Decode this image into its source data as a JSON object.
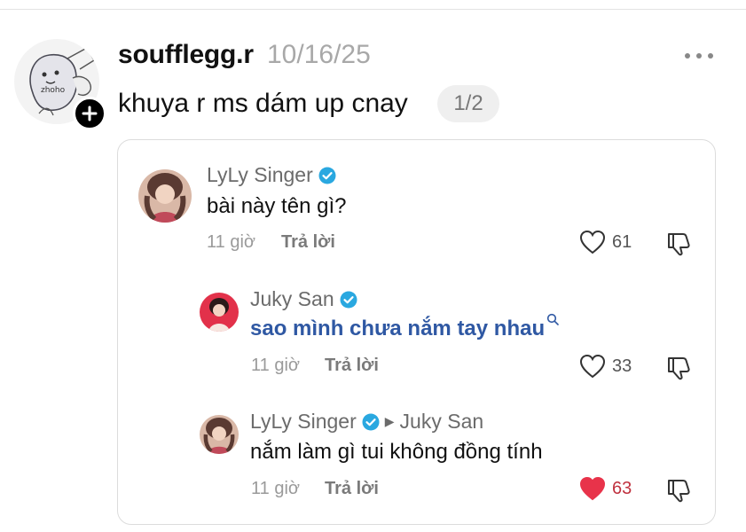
{
  "post": {
    "username": "soufflegg.r",
    "date": "10/16/25",
    "caption": "khuya r ms dám up cnay",
    "page_indicator": "1/2",
    "avatar_doodle_text": "zhoho"
  },
  "comments": [
    {
      "author": "LyLy Singer",
      "verified": true,
      "text": "bài này tên gì?",
      "time": "11 giờ",
      "reply_label": "Trả lời",
      "likes": "61",
      "liked": false
    },
    {
      "author": "Juky San",
      "verified": true,
      "text": "sao mình chưa nắm tay nhau",
      "text_is_song_link": true,
      "time": "11 giờ",
      "reply_label": "Trả lời",
      "likes": "33",
      "liked": false
    },
    {
      "author": "LyLy Singer",
      "verified": true,
      "reply_to": "Juky San",
      "text": "nắm làm gì tui không đồng tính",
      "time": "11 giờ",
      "reply_label": "Trả lời",
      "likes": "63",
      "liked": true
    }
  ],
  "colors": {
    "verified_badge": "#2aa8e0",
    "song_link": "#2f58a3",
    "liked_heart": "#e8334a",
    "timestamp_gray": "#a8a8a8"
  },
  "icons": {
    "more": "more-dots-icon",
    "follow": "plus-icon",
    "verified": "verified-check-icon",
    "like": "heart-icon",
    "dislike": "thumbs-down-icon",
    "search": "search-icon",
    "reply_to": "play-arrow-icon"
  }
}
